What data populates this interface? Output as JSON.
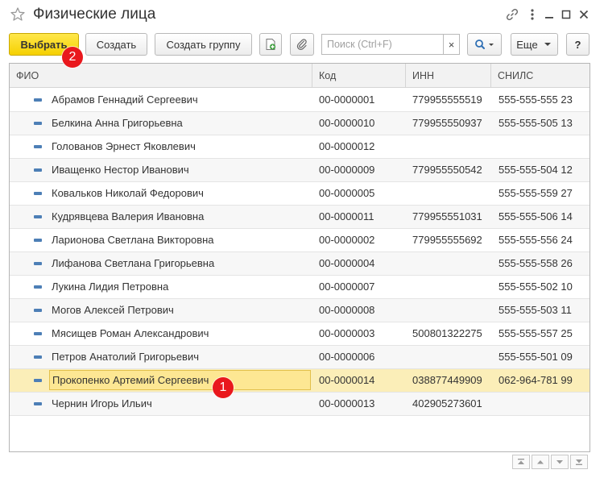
{
  "window": {
    "title": "Физические лица"
  },
  "toolbar": {
    "select_label": "Выбрать",
    "create_label": "Создать",
    "create_group_label": "Создать группу",
    "more_label": "Еще",
    "help_label": "?",
    "clear_label": "×"
  },
  "search": {
    "placeholder": "Поиск (Ctrl+F)",
    "value": ""
  },
  "table": {
    "columns": [
      "ФИО",
      "Код",
      "ИНН",
      "СНИЛС"
    ],
    "rows": [
      {
        "name": "Абрамов Геннадий Сергеевич",
        "code": "00-0000001",
        "inn": "779955555519",
        "snils": "555-555-555 23"
      },
      {
        "name": "Белкина Анна Григорьевна",
        "code": "00-0000010",
        "inn": "779955550937",
        "snils": "555-555-505 13"
      },
      {
        "name": "Голованов Эрнест Яковлевич",
        "code": "00-0000012",
        "inn": "",
        "snils": ""
      },
      {
        "name": "Иващенко Нестор Иванович",
        "code": "00-0000009",
        "inn": "779955550542",
        "snils": "555-555-504 12"
      },
      {
        "name": "Ковальков Николай Федорович",
        "code": "00-0000005",
        "inn": "",
        "snils": "555-555-559 27"
      },
      {
        "name": "Кудрявцева Валерия Ивановна",
        "code": "00-0000011",
        "inn": "779955551031",
        "snils": "555-555-506 14"
      },
      {
        "name": "Ларионова Светлана Викторовна",
        "code": "00-0000002",
        "inn": "779955555692",
        "snils": "555-555-556 24"
      },
      {
        "name": "Лифанова Светлана Григорьевна",
        "code": "00-0000004",
        "inn": "",
        "snils": "555-555-558 26"
      },
      {
        "name": "Лукина Лидия Петровна",
        "code": "00-0000007",
        "inn": "",
        "snils": "555-555-502 10"
      },
      {
        "name": "Могов Алексей Петрович",
        "code": "00-0000008",
        "inn": "",
        "snils": "555-555-503 11"
      },
      {
        "name": "Мясищев Роман Александрович",
        "code": "00-0000003",
        "inn": "500801322275",
        "snils": "555-555-557 25"
      },
      {
        "name": "Петров Анатолий Григорьевич",
        "code": "00-0000006",
        "inn": "",
        "snils": "555-555-501 09"
      },
      {
        "name": "Прокопенко Артемий Сергеевич",
        "code": "00-0000014",
        "inn": "038877449909",
        "snils": "062-964-781 99"
      },
      {
        "name": "Чернин Игорь Ильич",
        "code": "00-0000013",
        "inn": "402905273601",
        "snils": ""
      }
    ],
    "selected_row": 12
  },
  "badges": [
    "1",
    "2"
  ],
  "colors": {
    "primary_button": "#f5d000",
    "selected_row": "#fbeeb8",
    "badge": "#e9181d",
    "row_icon": "#4d7fb6"
  },
  "icons": {
    "favorite": "star-icon",
    "link": "link-icon",
    "menu": "kebab-menu-icon",
    "minimize": "minimize-icon",
    "maximize": "maximize-icon",
    "close": "close-icon",
    "add_document": "add-document-icon",
    "attach": "paperclip-icon",
    "search": "magnifier-icon"
  }
}
